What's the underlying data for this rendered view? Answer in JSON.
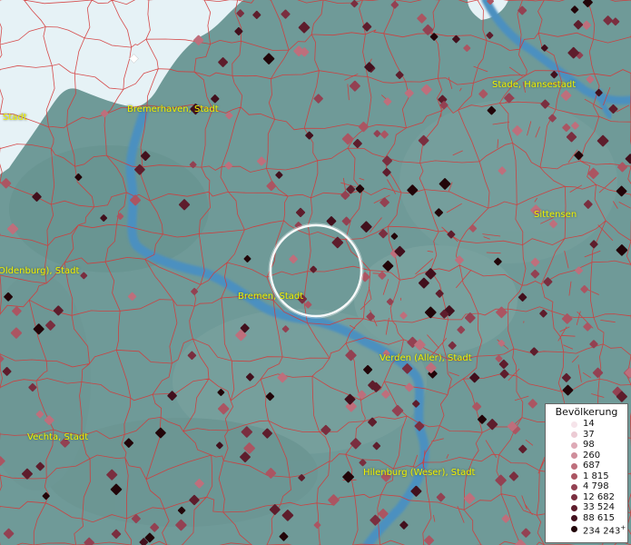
{
  "legend": {
    "title": "Bevölkerung",
    "entries": [
      {
        "label": "14",
        "color": "#f6e4ea"
      },
      {
        "label": "37",
        "color": "#eccbd4"
      },
      {
        "label": "98",
        "color": "#deaab6"
      },
      {
        "label": "260",
        "color": "#cf8e9b"
      },
      {
        "label": "687",
        "color": "#be6f7c"
      },
      {
        "label": "1 815",
        "color": "#ab5562"
      },
      {
        "label": "4 798",
        "color": "#934152"
      },
      {
        "label": "12 682",
        "color": "#7a2e3f"
      },
      {
        "label": "33 524",
        "color": "#5e1d2c"
      },
      {
        "label": "88 615",
        "color": "#42101d"
      },
      {
        "label": "234 243",
        "color": "#220509",
        "plus": "+"
      }
    ]
  },
  "places": [
    {
      "name": "Stade, Hansestadt"
    },
    {
      "name": "Bremerhaven, Stadt"
    },
    {
      "name": "Stadt"
    },
    {
      "name": "Sittensen"
    },
    {
      "name": "Oldenburg), Stadt"
    },
    {
      "name": "Bremen, Stadt"
    },
    {
      "name": "Verden (Aller), Stadt"
    },
    {
      "name": "Vechta, Stadt"
    },
    {
      "name": "Hilenburg (Weser), Stadt"
    }
  ],
  "colors": {
    "land": "#6f9a98",
    "water": "#e6f2f6",
    "river": "#4b90c0",
    "boundary": "#d43838",
    "label": "#f2f200"
  }
}
